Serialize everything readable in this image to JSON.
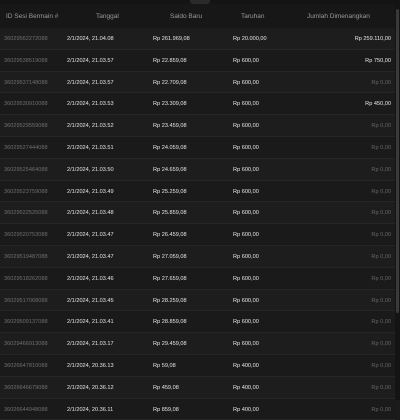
{
  "headers": {
    "id": "ID Sesi Bermain #",
    "date": "Tanggal",
    "balance": "Saldo Baru",
    "bet": "Taruhan",
    "win": "Jumlah Dimenangkan"
  },
  "rows": [
    {
      "id": "36029562272088",
      "date": "2/1/2024, 21.04.08",
      "balance": "Rp 261.969,08",
      "bet": "Rp 20.000,00",
      "win": "Rp 259.110,00",
      "positive": true
    },
    {
      "id": "36029538519088",
      "date": "2/1/2024, 21.03.57",
      "balance": "Rp 22.859,08",
      "bet": "Rp 600,00",
      "win": "Rp 750,00",
      "positive": true
    },
    {
      "id": "36029537148088",
      "date": "2/1/2024, 21.03.57",
      "balance": "Rp 22.709,08",
      "bet": "Rp 600,00",
      "win": "Rp 0,00",
      "positive": false
    },
    {
      "id": "36029530910088",
      "date": "2/1/2024, 21.03.53",
      "balance": "Rp 23.309,08",
      "bet": "Rp 600,00",
      "win": "Rp 450,00",
      "positive": true
    },
    {
      "id": "36029529559088",
      "date": "2/1/2024, 21.03.52",
      "balance": "Rp 23.459,08",
      "bet": "Rp 600,00",
      "win": "Rp 0,00",
      "positive": false
    },
    {
      "id": "36029527444088",
      "date": "2/1/2024, 21.03.51",
      "balance": "Rp 24.059,08",
      "bet": "Rp 600,00",
      "win": "Rp 0,00",
      "positive": false
    },
    {
      "id": "36029525464088",
      "date": "2/1/2024, 21.03.50",
      "balance": "Rp 24.659,08",
      "bet": "Rp 600,00",
      "win": "Rp 0,00",
      "positive": false
    },
    {
      "id": "36029523759088",
      "date": "2/1/2024, 21.03.49",
      "balance": "Rp 25.259,08",
      "bet": "Rp 600,00",
      "win": "Rp 0,00",
      "positive": false
    },
    {
      "id": "36029522525088",
      "date": "2/1/2024, 21.03.48",
      "balance": "Rp 25.859,08",
      "bet": "Rp 600,00",
      "win": "Rp 0,00",
      "positive": false
    },
    {
      "id": "36029520753088",
      "date": "2/1/2024, 21.03.47",
      "balance": "Rp 26.459,08",
      "bet": "Rp 600,00",
      "win": "Rp 0,00",
      "positive": false
    },
    {
      "id": "36029519487088",
      "date": "2/1/2024, 21.03.47",
      "balance": "Rp 27.059,08",
      "bet": "Rp 600,00",
      "win": "Rp 0,00",
      "positive": false
    },
    {
      "id": "36029518262088",
      "date": "2/1/2024, 21.03.46",
      "balance": "Rp 27.659,08",
      "bet": "Rp 600,00",
      "win": "Rp 0,00",
      "positive": false
    },
    {
      "id": "36029517068088",
      "date": "2/1/2024, 21.03.45",
      "balance": "Rp 28.259,08",
      "bet": "Rp 600,00",
      "win": "Rp 0,00",
      "positive": false
    },
    {
      "id": "36029509137088",
      "date": "2/1/2024, 21.03.41",
      "balance": "Rp 28.859,08",
      "bet": "Rp 600,00",
      "win": "Rp 0,00",
      "positive": false
    },
    {
      "id": "36029466913088",
      "date": "2/1/2024, 21.03.17",
      "balance": "Rp 29.459,08",
      "bet": "Rp 600,00",
      "win": "Rp 0,00",
      "positive": false
    },
    {
      "id": "36026647810088",
      "date": "2/1/2024, 20.36.13",
      "balance": "Rp 59,08",
      "bet": "Rp 400,00",
      "win": "Rp 0,00",
      "positive": false
    },
    {
      "id": "36026646679088",
      "date": "2/1/2024, 20.36.12",
      "balance": "Rp 459,08",
      "bet": "Rp 400,00",
      "win": "Rp 0,00",
      "positive": false
    },
    {
      "id": "36026644948088",
      "date": "2/1/2024, 20.36.11",
      "balance": "Rp 859,08",
      "bet": "Rp 400,00",
      "win": "Rp 0,00",
      "positive": false
    }
  ]
}
